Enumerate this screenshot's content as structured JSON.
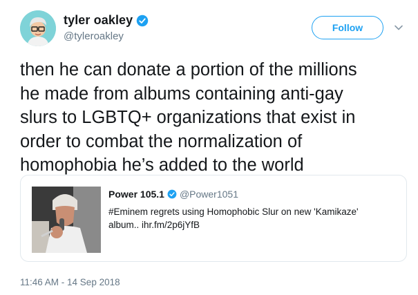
{
  "author": {
    "display_name": "tyler oakley",
    "handle": "@tyleroakley",
    "verified": true,
    "avatar_icon": "cartoon-avatar-icon"
  },
  "follow_button": {
    "label": "Follow"
  },
  "tweet": {
    "text": "then he can donate a portion of the millions\nhe made from albums containing anti-gay\nslurs to LGBTQ+ organizations that exist in\norder to combat the normalization of\nhomophobia he’s added to the world"
  },
  "quoted_tweet": {
    "display_name": "Power 105.1",
    "handle": "@Power1051",
    "verified": true,
    "text": "#Eminem regrets using Homophobic Slur on new 'Kamikaze'\nalbum.. ihr.fm/2p6jYfB",
    "image_icon": "eminem-photo-thumbnail"
  },
  "timestamp": "11:46 AM - 14 Sep 2018",
  "colors": {
    "accent": "#1da1f2",
    "text_primary": "#14171a",
    "text_secondary": "#657786",
    "border": "#e1e8ed"
  }
}
